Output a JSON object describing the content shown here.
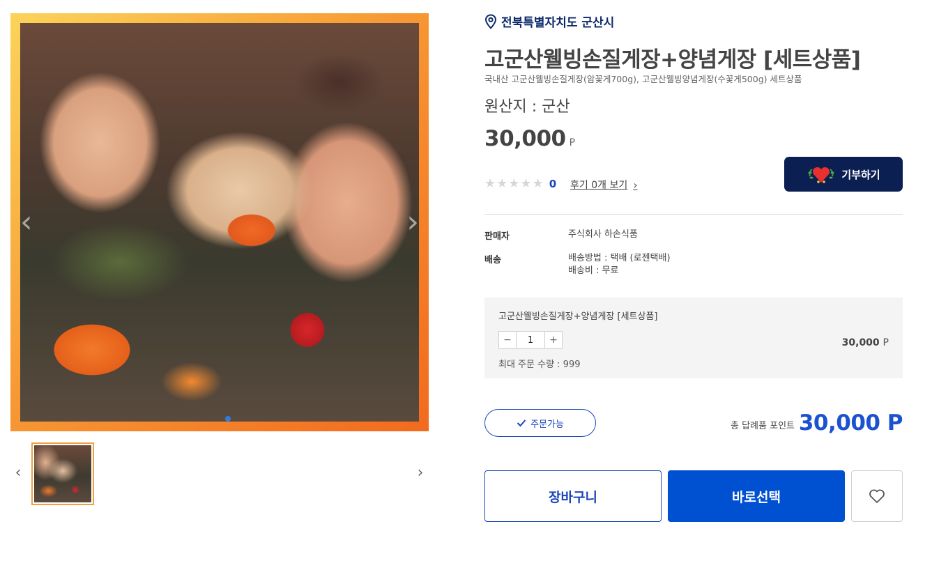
{
  "gallery": {
    "prev_arrow": "‹",
    "next_arrow": "›",
    "thumb_prev": "‹",
    "thumb_next": "›",
    "accent_color": "#f79a35"
  },
  "product": {
    "location": "전북특별자치도 군산시",
    "title": "고군산웰빙손질게장+양념게장 [세트상품]",
    "subtitle": "국내산 고군산웰빙손질게장(암꽃게700g), 고군산웰빙양념게장(수꽃게500g) 세트상품",
    "origin": "원산지 : 군산",
    "price": "30,000",
    "price_unit": "P"
  },
  "rating": {
    "count": "0",
    "review_link": "후기 0개 보기",
    "review_chevron": "›"
  },
  "donate": {
    "label": "기부하기",
    "color": "#0b1f52"
  },
  "info": {
    "seller_label": "판매자",
    "seller_value": "주식회사 하손식품",
    "shipping_label": "배송",
    "shipping_method": "배송방법 : 택배 (로젠택배)",
    "shipping_fee": "배송비 : 무료"
  },
  "option": {
    "name": "고군산웰빙손질게장+양념게장 [세트상품]",
    "minus": "−",
    "plus": "+",
    "quantity": "1",
    "max_qty": "최대 주문 수량 : 999",
    "price": "30,000",
    "price_unit": "P"
  },
  "order": {
    "status": "주문가능",
    "total_label": "총 답례품 포인트",
    "total_value": "30,000 P"
  },
  "actions": {
    "cart": "장바구니",
    "buy": "바로선택",
    "primary_color": "#0050d2"
  }
}
